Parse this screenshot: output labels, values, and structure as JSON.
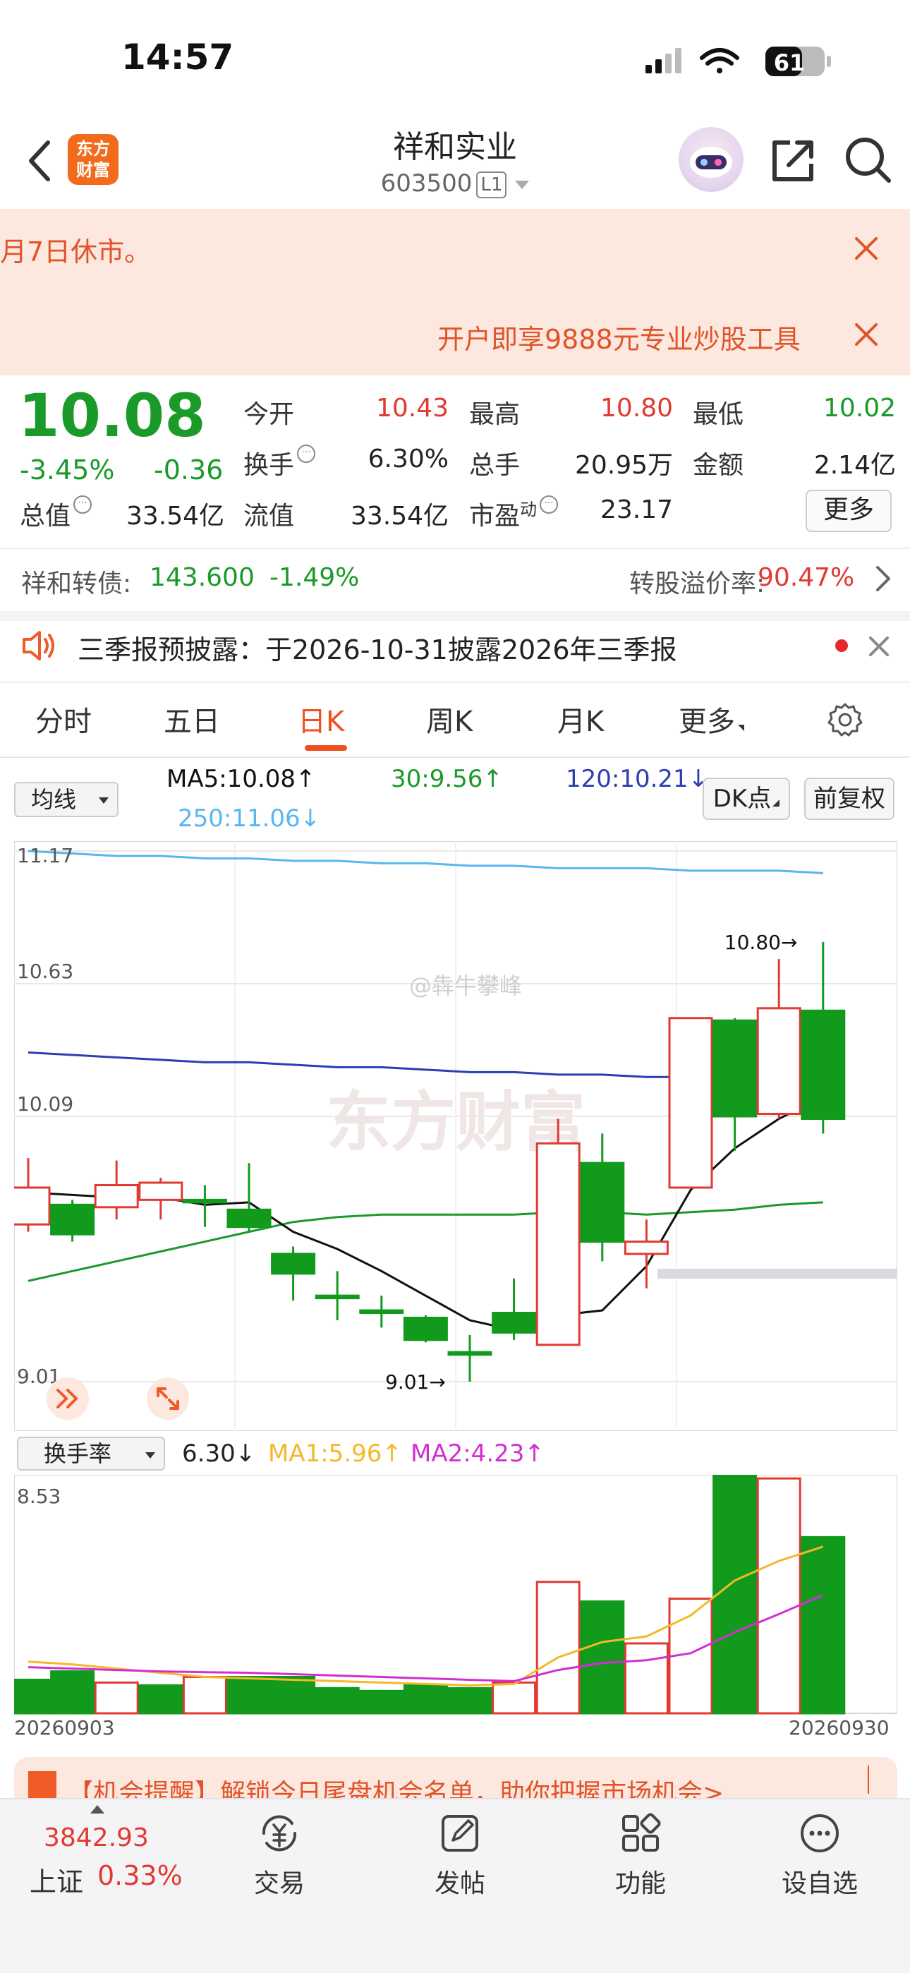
{
  "status": {
    "time": "14:57",
    "battery": "61"
  },
  "nav": {
    "logo_line1": "东方",
    "logo_line2": "财富",
    "stock_name": "祥和实业",
    "stock_code": "603500",
    "code_badge": "L1"
  },
  "notices": {
    "notice1": "月7日休市。",
    "notice2": "开户即享9888元专业炒股工具"
  },
  "quote": {
    "price": "10.08",
    "change_pct": "-3.45%",
    "change_val": "-0.36",
    "open_label": "今开",
    "open": "10.43",
    "high_label": "最高",
    "high": "10.80",
    "low_label": "最低",
    "low": "10.02",
    "turnover_label": "换手",
    "turnover": "6.30%",
    "volume_label": "总手",
    "volume": "20.95万",
    "amount_label": "金额",
    "amount": "2.14亿",
    "mcap_label": "总值",
    "mcap": "33.54亿",
    "float_label": "流值",
    "float": "33.54亿",
    "pe_label": "市盈",
    "pe_sup": "动",
    "pe": "23.17",
    "more_label": "更多"
  },
  "convertible": {
    "name": "祥和转债:",
    "price": "143.600",
    "change_pct": "-1.49%",
    "premium_label": "转股溢价率:",
    "premium": "90.47%"
  },
  "announcement": "三季报预披露：于2026-10-31披露2026年三季报",
  "tabs": [
    "分时",
    "五日",
    "日K",
    "周K",
    "月K",
    "更多"
  ],
  "indicators": {
    "ma_select": "均线",
    "ma5": "MA5:10.08",
    "ma30": "30:9.56",
    "ma120": "120:10.21",
    "ma250": "250:11.06",
    "dk_label": "DK点",
    "adjust_label": "前复权"
  },
  "volume_panel": {
    "select": "换手率",
    "value": "6.30",
    "ma1": "MA1:5.96",
    "ma2": "MA2:4.23",
    "axis_top": "8.53"
  },
  "watermark": {
    "weibo": "@犇牛攀峰",
    "brand": "东方财富"
  },
  "colors": {
    "up": "#e03a32",
    "down": "#119a1c",
    "ma5": "#111111",
    "ma30": "#1a9a28",
    "ma120": "#2d3fb0",
    "ma250": "#58b6f0",
    "vol_ma1": "#f5b82a",
    "vol_ma2": "#d22fd2"
  },
  "chart_data": [
    {
      "type": "candlestick",
      "y_axis_labels": [
        "11.17",
        "10.63",
        "10.09",
        "9.01"
      ],
      "ylim": [
        9.01,
        11.17
      ],
      "x_start_label": "20260903",
      "x_end_label": "20260930",
      "annotations": {
        "high": "10.80→",
        "low": "9.01→"
      },
      "candles": [
        {
          "o": 9.65,
          "c": 9.8,
          "h": 9.92,
          "l": 9.62
        },
        {
          "o": 9.73,
          "c": 9.61,
          "h": 9.75,
          "l": 9.58
        },
        {
          "o": 9.72,
          "c": 9.81,
          "h": 9.91,
          "l": 9.67
        },
        {
          "o": 9.75,
          "c": 9.82,
          "h": 9.84,
          "l": 9.67
        },
        {
          "o": 9.75,
          "c": 9.74,
          "h": 9.81,
          "l": 9.64
        },
        {
          "o": 9.71,
          "c": 9.64,
          "h": 9.9,
          "l": 9.62
        },
        {
          "o": 9.53,
          "c": 9.45,
          "h": 9.56,
          "l": 9.34
        },
        {
          "o": 9.36,
          "c": 9.35,
          "h": 9.46,
          "l": 9.26
        },
        {
          "o": 9.3,
          "c": 9.29,
          "h": 9.36,
          "l": 9.23
        },
        {
          "o": 9.27,
          "c": 9.18,
          "h": 9.28,
          "l": 9.17
        },
        {
          "o": 9.13,
          "c": 9.12,
          "h": 9.2,
          "l": 9.01
        },
        {
          "o": 9.29,
          "c": 9.21,
          "h": 9.43,
          "l": 9.18
        },
        {
          "o": 9.16,
          "c": 9.98,
          "h": 10.08,
          "l": 9.16
        },
        {
          "o": 9.9,
          "c": 9.58,
          "h": 10.02,
          "l": 9.5
        },
        {
          "o": 9.53,
          "c": 9.58,
          "h": 9.67,
          "l": 9.39
        },
        {
          "o": 9.8,
          "c": 10.49,
          "h": 10.49,
          "l": 9.8
        },
        {
          "o": 10.48,
          "c": 10.09,
          "h": 10.49,
          "l": 9.95
        },
        {
          "o": 10.1,
          "c": 10.53,
          "h": 10.73,
          "l": 10.08
        },
        {
          "o": 10.52,
          "c": 10.08,
          "h": 10.8,
          "l": 10.02
        }
      ],
      "ma5": [
        9.78,
        9.77,
        9.76,
        9.76,
        9.73,
        9.74,
        9.62,
        9.55,
        9.46,
        9.36,
        9.26,
        9.22,
        9.28,
        9.3,
        9.48,
        9.79,
        9.96,
        10.08,
        10.17
      ],
      "ma30": [
        9.42,
        9.46,
        9.5,
        9.54,
        9.58,
        9.62,
        9.66,
        9.68,
        9.69,
        9.69,
        9.69,
        9.69,
        9.7,
        9.7,
        9.69,
        9.7,
        9.71,
        9.73,
        9.74
      ],
      "ma120": [
        10.35,
        10.34,
        10.33,
        10.32,
        10.31,
        10.31,
        10.3,
        10.29,
        10.29,
        10.28,
        10.27,
        10.27,
        10.26,
        10.26,
        10.25,
        10.25,
        10.24,
        10.24,
        10.23
      ],
      "ma250": [
        11.17,
        11.16,
        11.15,
        11.15,
        11.14,
        11.14,
        11.13,
        11.13,
        11.12,
        11.12,
        11.11,
        11.11,
        11.1,
        11.1,
        11.1,
        11.09,
        11.09,
        11.09,
        11.08
      ]
    },
    {
      "type": "bar",
      "series_label": "换手率",
      "ylim": [
        0,
        8.53
      ],
      "values": [
        1.2,
        1.5,
        1.1,
        1.0,
        1.3,
        1.3,
        1.3,
        0.9,
        0.8,
        1.0,
        0.9,
        1.1,
        4.7,
        4.0,
        2.5,
        4.1,
        8.6,
        8.4,
        6.3
      ],
      "up": [
        false,
        false,
        true,
        false,
        true,
        false,
        false,
        false,
        false,
        false,
        false,
        true,
        true,
        false,
        true,
        true,
        false,
        true,
        false
      ],
      "ma1": [
        1.85,
        1.75,
        1.6,
        1.45,
        1.3,
        1.25,
        1.2,
        1.15,
        1.1,
        1.05,
        1.0,
        1.05,
        2.0,
        2.55,
        2.75,
        3.5,
        4.75,
        5.45,
        5.96
      ],
      "ma2": [
        1.65,
        1.6,
        1.55,
        1.5,
        1.47,
        1.45,
        1.4,
        1.35,
        1.3,
        1.25,
        1.2,
        1.15,
        1.55,
        1.8,
        1.9,
        2.15,
        2.9,
        3.55,
        4.23
      ]
    }
  ],
  "promo": "【机会提醒】解锁今日尾盘机会名单，助你把握市场机会>",
  "bottom_nav": {
    "index_value": "3842.93",
    "index_name": "上证",
    "index_pct": "0.33%",
    "items": [
      "交易",
      "发帖",
      "功能",
      "设自选"
    ]
  }
}
